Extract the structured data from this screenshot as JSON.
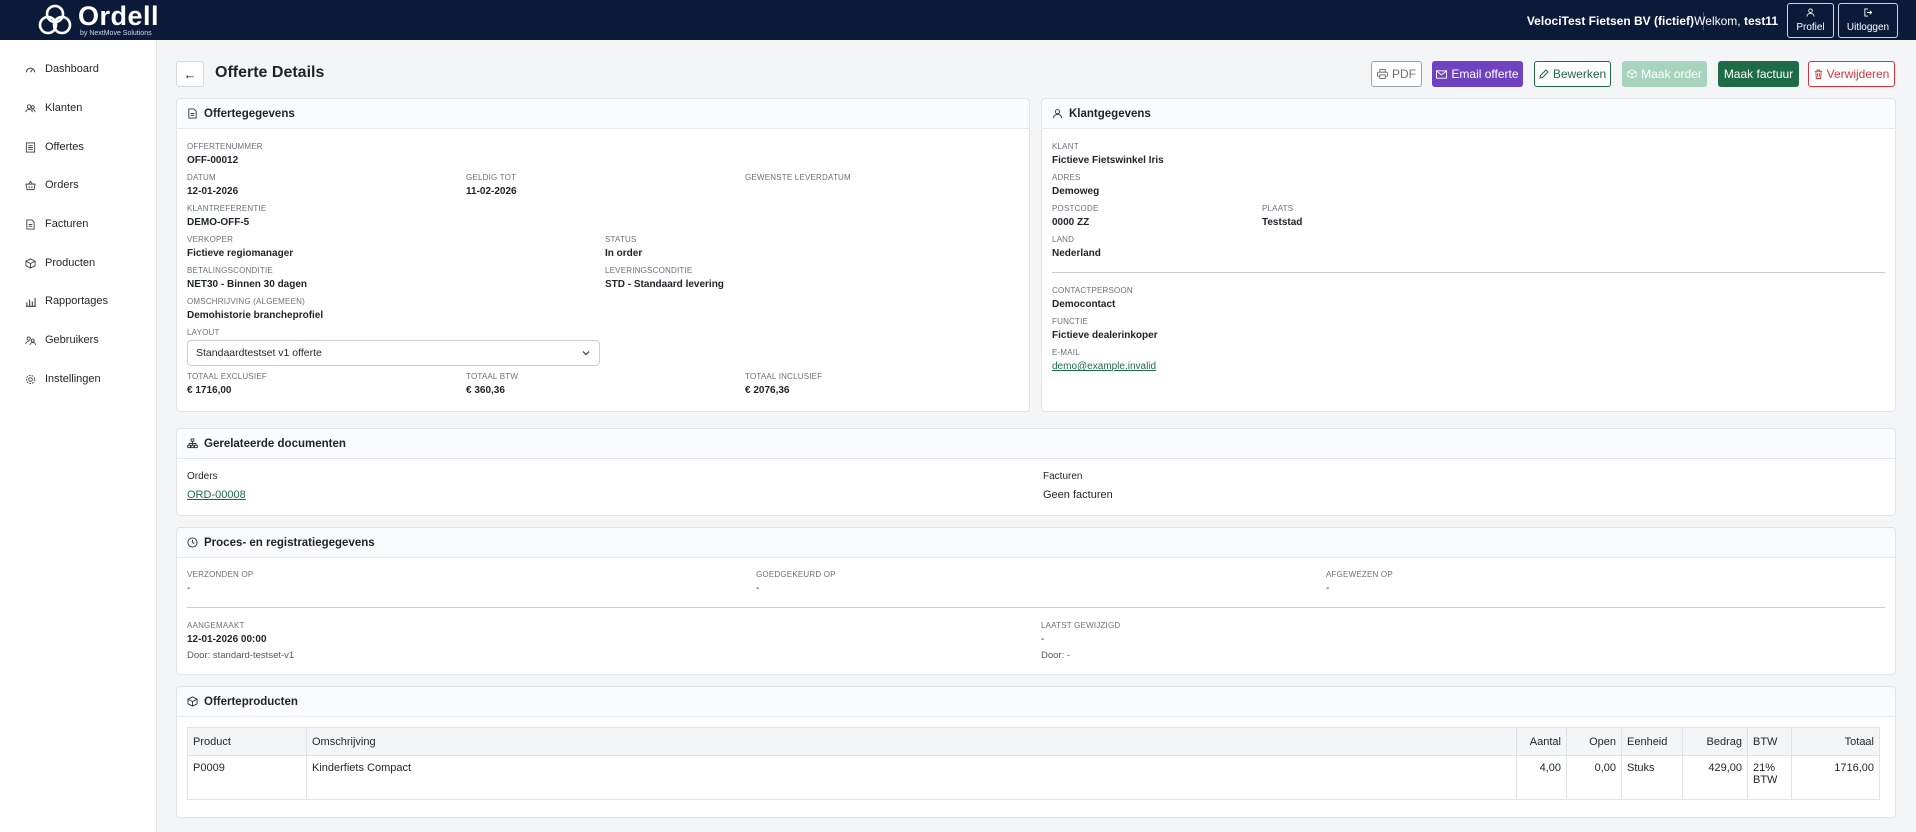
{
  "app": {
    "logo_name": "Ordell",
    "logo_sub": "by NextMove Solutions",
    "company": "VelociTest Fietsen BV (fictief)",
    "welcome_prefix": "Welkom, ",
    "username": "test11",
    "profile_label": "Profiel",
    "logout_label": "Uitloggen"
  },
  "sidebar": {
    "items": [
      {
        "label": "Dashboard",
        "icon": "dashboard-icon"
      },
      {
        "label": "Klanten",
        "icon": "users-icon"
      },
      {
        "label": "Offertes",
        "icon": "document-list-icon"
      },
      {
        "label": "Orders",
        "icon": "basket-icon"
      },
      {
        "label": "Facturen",
        "icon": "invoice-icon"
      },
      {
        "label": "Producten",
        "icon": "box-icon"
      },
      {
        "label": "Rapportages",
        "icon": "bar-chart-icon"
      },
      {
        "label": "Gebruikers",
        "icon": "user-group-icon"
      },
      {
        "label": "Instellingen",
        "icon": "gear-icon"
      }
    ]
  },
  "header": {
    "back_label": "←",
    "title": "Offerte Details",
    "actions": {
      "pdf": "PDF",
      "email": "Email offerte",
      "edit": "Bewerken",
      "make_order": "Maak order",
      "make_invoice": "Maak factuur",
      "delete": "Verwijderen"
    }
  },
  "offer": {
    "heading": "Offertegegevens",
    "number_label": "OFFERTENUMMER",
    "number": "OFF-00012",
    "date_label": "DATUM",
    "date": "12-01-2026",
    "valid_label": "GELDIG TOT",
    "valid": "11-02-2026",
    "delivery_label": "GEWENSTE LEVERDATUM",
    "delivery": "",
    "ref_label": "KLANTREFERENTIE",
    "ref": "DEMO-OFF-5",
    "seller_label": "VERKOPER",
    "seller": "Fictieve regiomanager",
    "status_label": "STATUS",
    "status": "In order",
    "payment_label": "BETALINGSCONDITIE",
    "payment": "NET30 - Binnen 30 dagen",
    "delivery_cond_label": "LEVERINGSCONDITIE",
    "delivery_cond": "STD - Standaard levering",
    "desc_label": "OMSCHRIJVING (ALGEMEEN)",
    "desc": "Demohistorie brancheprofiel",
    "layout_label": "LAYOUT",
    "layout_value": "Standaardtestset v1 offerte",
    "total_excl_label": "TOTAAL EXCLUSIEF",
    "total_excl": "€ 1716,00",
    "total_vat_label": "TOTAAL BTW",
    "total_vat": "€ 360,36",
    "total_incl_label": "TOTAAL INCLUSIEF",
    "total_incl": "€ 2076,36"
  },
  "customer": {
    "heading": "Klantgegevens",
    "client_label": "KLANT",
    "client": "Fictieve Fietswinkel Iris",
    "address_label": "ADRES",
    "address": "Demoweg",
    "postcode_label": "POSTCODE",
    "postcode": "0000 ZZ",
    "city_label": "PLAATS",
    "city": "Teststad",
    "country_label": "LAND",
    "country": "Nederland",
    "contact_label": "CONTACTPERSOON",
    "contact": "Democontact",
    "function_label": "FUNCTIE",
    "function": "Fictieve dealerinkoper",
    "email_label": "E-MAIL",
    "email": "demo@example.invalid"
  },
  "related": {
    "heading": "Gerelateerde documenten",
    "orders_label": "Orders",
    "orders_value": "ORD-00008",
    "invoices_label": "Facturen",
    "invoices_value": "Geen facturen"
  },
  "process": {
    "heading": "Proces- en registratiegegevens",
    "sent_label": "VERZONDEN OP",
    "sent": "-",
    "approved_label": "GOEDGEKEURD OP",
    "approved": "-",
    "rejected_label": "AFGEWEZEN OP",
    "rejected": "-",
    "created_label": "AANGEMAAKT",
    "created": "12-01-2026 00:00",
    "created_by": "Door: standard-testset-v1",
    "modified_label": "LAATST GEWIJZIGD",
    "modified": "-",
    "modified_by": "Door: -"
  },
  "products": {
    "heading": "Offerteproducten",
    "columns": [
      "Product",
      "Omschrijving",
      "Aantal",
      "Open",
      "Eenheid",
      "Bedrag",
      "BTW",
      "Totaal"
    ],
    "rows": [
      {
        "product": "P0009",
        "description": "Kinderfiets Compact",
        "qty": "4,00",
        "open": "0,00",
        "unit": "Stuks",
        "amount": "429,00",
        "vat": "21% BTW",
        "total": "1716,00"
      }
    ]
  },
  "colors": {
    "topbar": "#0c1a3a",
    "primary_green": "#1e6b48",
    "purple": "#6f42c1",
    "danger": "#d9343e"
  }
}
